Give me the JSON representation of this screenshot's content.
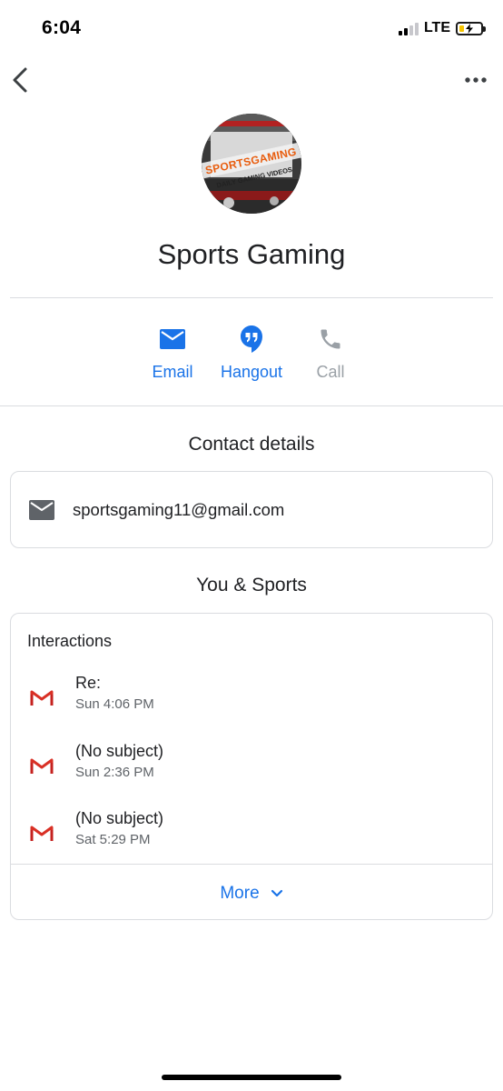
{
  "status_bar": {
    "time": "6:04",
    "network": "LTE"
  },
  "contact": {
    "name": "Sports Gaming",
    "avatar": {
      "logo_text": "SPORTSGAMING",
      "tagline": "DAILY GAMING VIDEOS"
    }
  },
  "actions": [
    {
      "label": "Email",
      "icon": "email-icon",
      "enabled": true
    },
    {
      "label": "Hangout",
      "icon": "hangouts-icon",
      "enabled": true
    },
    {
      "label": "Call",
      "icon": "phone-icon",
      "enabled": false
    }
  ],
  "contact_details": {
    "title": "Contact details",
    "email": "sportsgaming11@gmail.com"
  },
  "you_and": {
    "title": "You & Sports",
    "interactions_title": "Interactions",
    "items": [
      {
        "subject": "Re:",
        "time": "Sun 4:06 PM"
      },
      {
        "subject": "(No subject)",
        "time": "Sun 2:36 PM"
      },
      {
        "subject": "(No subject)",
        "time": "Sat 5:29 PM"
      }
    ],
    "more_label": "More"
  },
  "colors": {
    "accent": "#1a73e8",
    "disabled": "#9aa0a6",
    "gmail_red": "#d93025"
  }
}
